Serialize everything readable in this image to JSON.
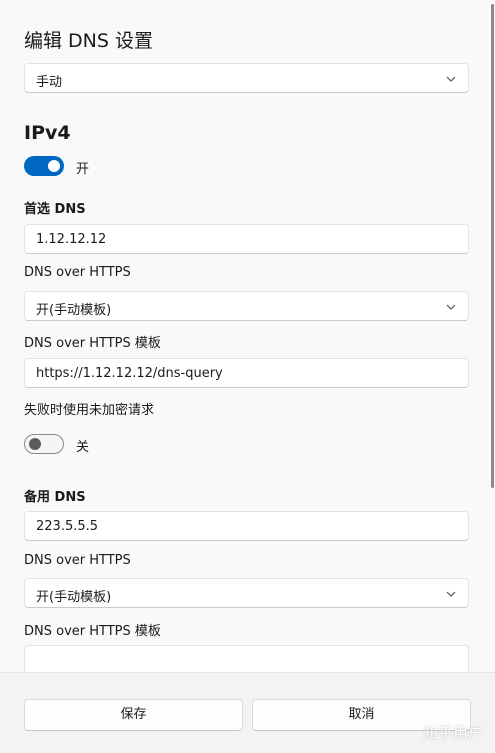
{
  "dialog": {
    "title": "编辑 DNS 设置",
    "mode_select": {
      "value": "手动"
    }
  },
  "ipv4": {
    "heading": "IPv4",
    "toggle_label": "开",
    "toggle_on": true,
    "preferred": {
      "label": "首选 DNS",
      "value": "1.12.12.12",
      "doh_label": "DNS over HTTPS",
      "doh_value": "开(手动模板)",
      "template_label": "DNS over HTTPS 模板",
      "template_value": "https://1.12.12.12/dns-query",
      "fallback_label": "失败时使用未加密请求",
      "fallback_toggle_label": "关",
      "fallback_on": false
    },
    "alternate": {
      "label": "备用 DNS",
      "value": "223.5.5.5",
      "doh_label": "DNS over HTTPS",
      "doh_value": "开(手动模板)",
      "template_label": "DNS over HTTPS 模板"
    }
  },
  "footer": {
    "save_label": "保存",
    "cancel_label": "取消"
  },
  "watermark": "知乎用户",
  "colors": {
    "accent": "#0067c0",
    "background": "#f9f9f9",
    "footer": "#f3f3f3"
  },
  "icons": [
    "chevron-down-icon"
  ]
}
